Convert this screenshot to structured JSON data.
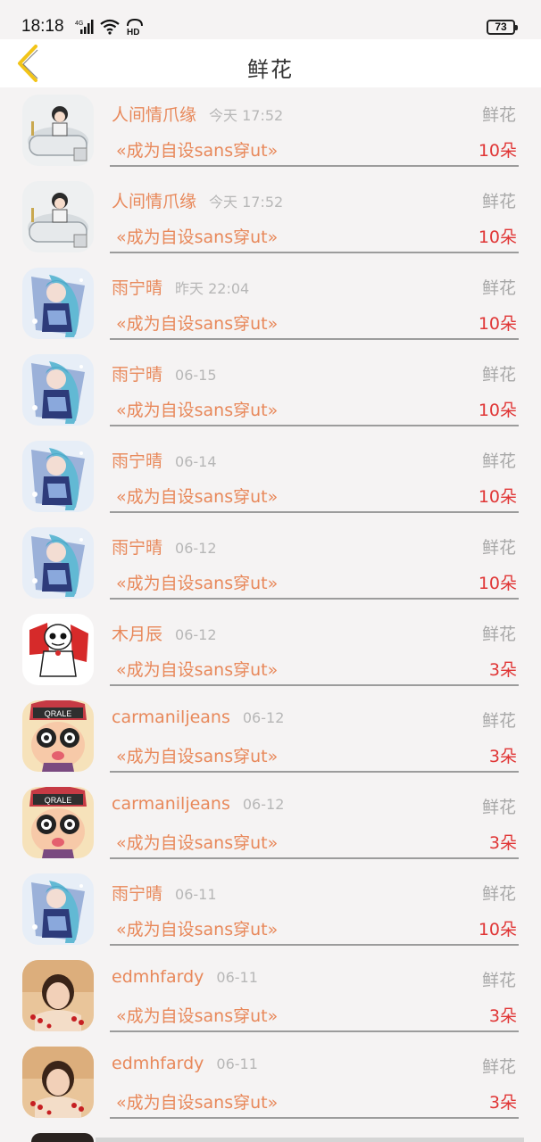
{
  "status_bar": {
    "time": "18:18",
    "network": "4G",
    "hd": "HD",
    "battery": "73"
  },
  "header": {
    "title": "鲜花"
  },
  "items": [
    {
      "name": "人间情爪缘",
      "time": "今天 17:52",
      "type": "鲜花",
      "title": "«成为自设sans穿ut»",
      "count": "10朵",
      "avatar": "bath"
    },
    {
      "name": "人间情爪缘",
      "time": "今天 17:52",
      "type": "鲜花",
      "title": "«成为自设sans穿ut»",
      "count": "10朵",
      "avatar": "bath"
    },
    {
      "name": "雨宁晴",
      "time": "昨天 22:04",
      "type": "鲜花",
      "title": "«成为自设sans穿ut»",
      "count": "10朵",
      "avatar": "anime-blue"
    },
    {
      "name": "雨宁晴",
      "time": "06-15",
      "type": "鲜花",
      "title": "«成为自设sans穿ut»",
      "count": "10朵",
      "avatar": "anime-blue"
    },
    {
      "name": "雨宁晴",
      "time": "06-14",
      "type": "鲜花",
      "title": "«成为自设sans穿ut»",
      "count": "10朵",
      "avatar": "anime-blue"
    },
    {
      "name": "雨宁晴",
      "time": "06-12",
      "type": "鲜花",
      "title": "«成为自设sans穿ut»",
      "count": "10朵",
      "avatar": "anime-blue"
    },
    {
      "name": "木月辰",
      "time": "06-12",
      "type": "鲜花",
      "title": "«成为自设sans穿ut»",
      "count": "3朵",
      "avatar": "skeleton"
    },
    {
      "name": "carmaniljeans",
      "time": "06-12",
      "type": "鲜花",
      "title": "«成为自设sans穿ut»",
      "count": "3朵",
      "avatar": "arale"
    },
    {
      "name": "carmaniljeans",
      "time": "06-12",
      "type": "鲜花",
      "title": "«成为自设sans穿ut»",
      "count": "3朵",
      "avatar": "arale"
    },
    {
      "name": "雨宁晴",
      "time": "06-11",
      "type": "鲜花",
      "title": "«成为自设sans穿ut»",
      "count": "10朵",
      "avatar": "anime-blue"
    },
    {
      "name": "edmhfardy",
      "time": "06-11",
      "type": "鲜花",
      "title": "«成为自设sans穿ut»",
      "count": "3朵",
      "avatar": "photo-girl"
    },
    {
      "name": "edmhfardy",
      "time": "06-11",
      "type": "鲜花",
      "title": "«成为自设sans穿ut»",
      "count": "3朵",
      "avatar": "photo-girl"
    }
  ]
}
